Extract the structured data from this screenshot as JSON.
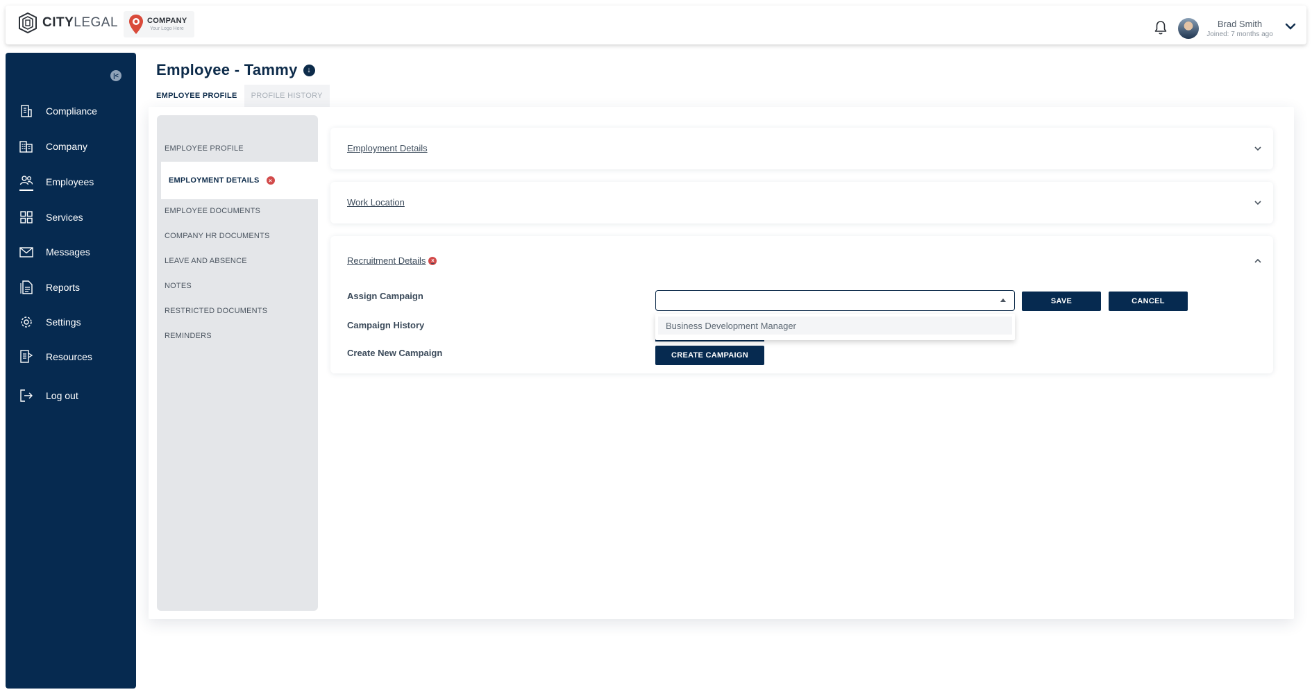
{
  "header": {
    "brand_bold": "CITY",
    "brand_light": "LEGAL",
    "company_title": "COMPANY",
    "company_subtitle": "Your Logo Here",
    "user_name": "Brad Smith",
    "user_joined": "Joined: 7 months ago"
  },
  "sidebar": {
    "items": [
      {
        "label": "Compliance",
        "icon": "compliance-icon"
      },
      {
        "label": "Company",
        "icon": "company-building-icon"
      },
      {
        "label": "Employees",
        "icon": "employees-icon"
      },
      {
        "label": "Services",
        "icon": "services-grid-icon"
      },
      {
        "label": "Messages",
        "icon": "envelope-icon"
      },
      {
        "label": "Reports",
        "icon": "reports-icon"
      },
      {
        "label": "Settings",
        "icon": "gear-icon"
      },
      {
        "label": "Resources",
        "icon": "resources-icon"
      },
      {
        "label": "Log out",
        "icon": "logout-icon"
      }
    ],
    "active": "Employees"
  },
  "page": {
    "title": "Employee - Tammy",
    "tabs": [
      {
        "label": "EMPLOYEE PROFILE",
        "active": true
      },
      {
        "label": "PROFILE HISTORY",
        "active": false
      }
    ]
  },
  "subnav": {
    "items": [
      "EMPLOYEE PROFILE",
      "EMPLOYMENT DETAILS",
      "EMPLOYEE DOCUMENTS",
      "COMPANY HR DOCUMENTS",
      "LEAVE AND ABSENCE",
      "NOTES",
      "RESTRICTED DOCUMENTS",
      "REMINDERS"
    ],
    "active": "EMPLOYMENT DETAILS"
  },
  "sections": {
    "employment_details": "Employment Details",
    "work_location": "Work Location",
    "recruitment_details": "Recruitment Details"
  },
  "recruitment": {
    "assign_campaign_label": "Assign Campaign",
    "campaign_history_label": "Campaign History",
    "create_new_campaign_label": "Create New Campaign",
    "select_value": "",
    "dropdown_options": [
      "Business Development Manager"
    ],
    "save_label": "SAVE",
    "cancel_label": "CANCEL",
    "create_campaign_label": "CREATE CAMPAIGN"
  },
  "colors": {
    "navy": "#062a50",
    "error": "#d24a4a",
    "subnav_bg": "#e4e6e9"
  }
}
